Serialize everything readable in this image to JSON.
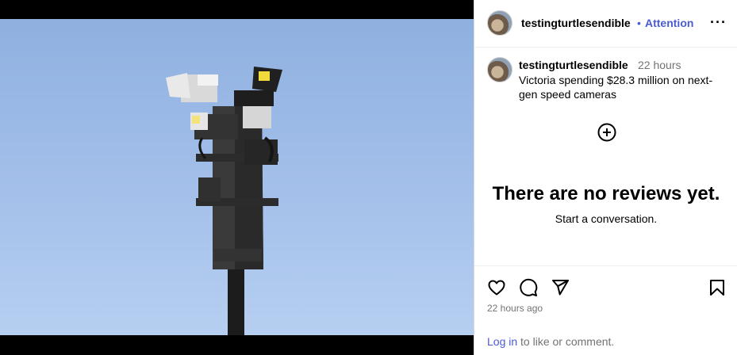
{
  "post": {
    "image_alt": "Speed camera pole with mounted cameras against blue sky"
  },
  "header": {
    "username": "testingturtlesendible",
    "separator": "•",
    "attention_label": "Attention",
    "more_label": "···"
  },
  "caption": {
    "username": "testingturtlesendible",
    "time": "22 hours",
    "text": "Victoria spending $28.3 million on next-gen speed cameras"
  },
  "reviews": {
    "empty_title": "There are no reviews yet.",
    "empty_subtitle": "Start a conversation."
  },
  "actions": {
    "posted_time": "22 hours ago",
    "login_link": "Log in",
    "login_suffix": " to like or comment."
  },
  "colors": {
    "accent": "#4a5bd4",
    "muted": "#737373",
    "sky": "#a4c0ea"
  }
}
